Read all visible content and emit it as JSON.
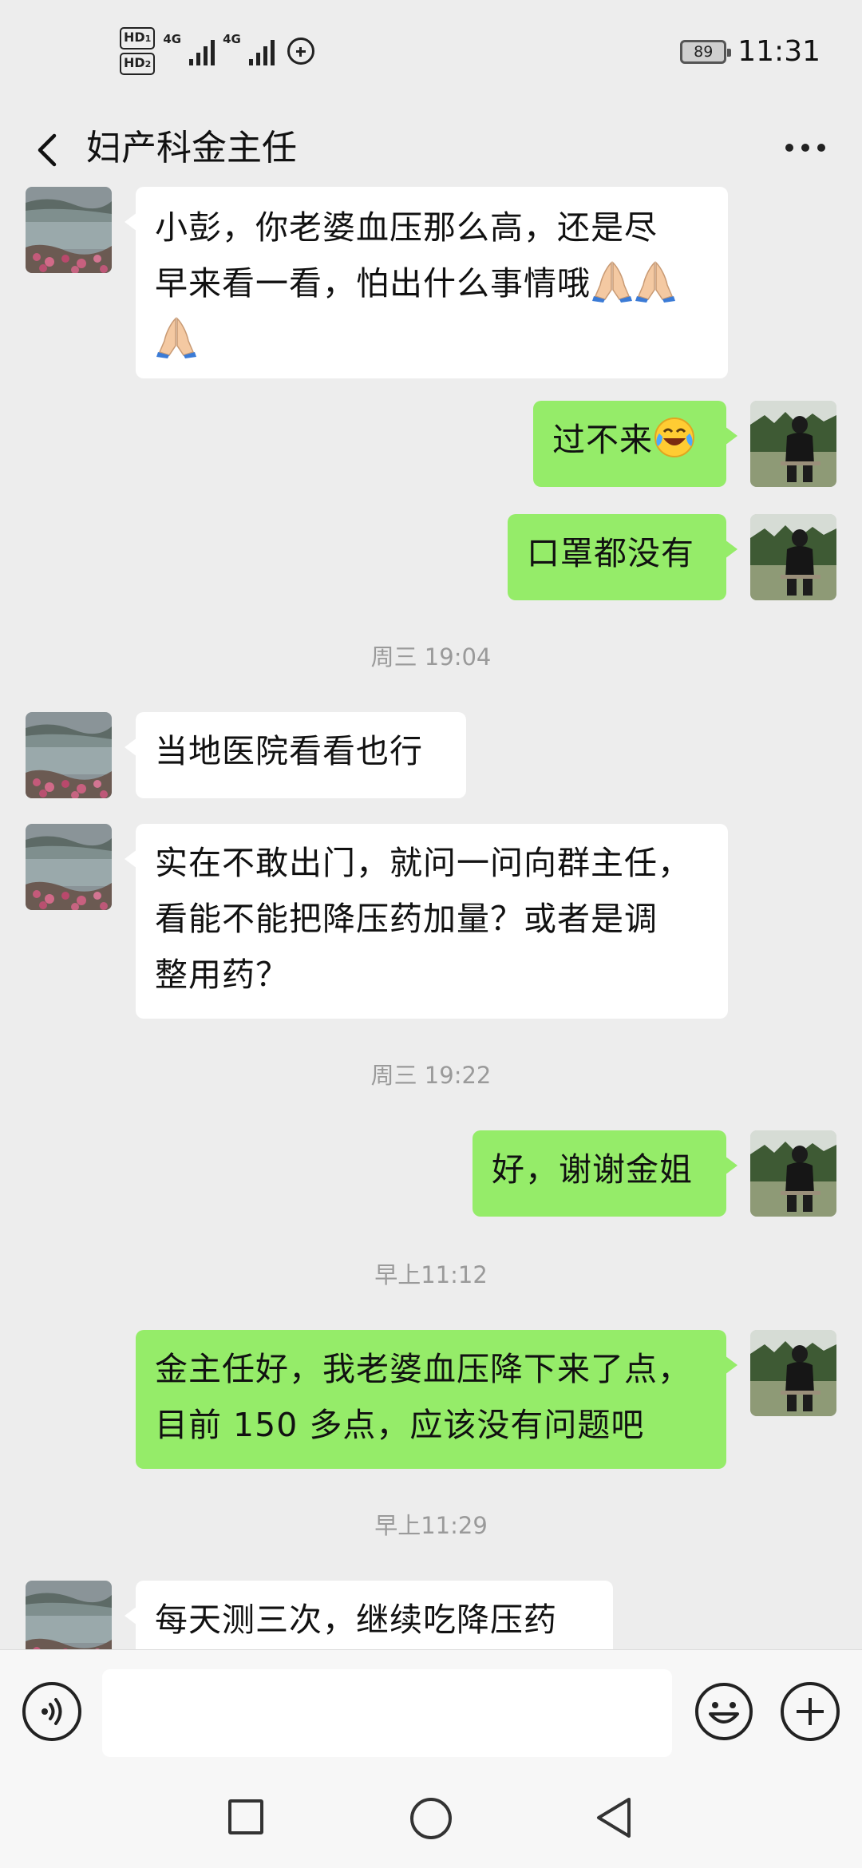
{
  "status_bar": {
    "hd1": "HD",
    "hd1_sub": "1",
    "hd2": "HD",
    "hd2_sub": "2",
    "net1": "4G",
    "net2": "4G",
    "battery": "89",
    "time": "11:31"
  },
  "header": {
    "title": "妇产科金主任",
    "back_icon": "chevron-left-icon",
    "more_icon": "more-dots-icon"
  },
  "messages": [
    {
      "side": "in",
      "text": "小彭，你老婆血压那么高，还是尽早来看一看，怕出什么事情哦",
      "emojis": [
        "pray",
        "pray",
        "pray"
      ]
    },
    {
      "side": "out",
      "text": "过不来",
      "emojis": [
        "face-with-tears"
      ]
    },
    {
      "side": "out",
      "text": "口罩都没有"
    },
    {
      "type": "time",
      "text": "周三 19:04"
    },
    {
      "side": "in",
      "text": "当地医院看看也行"
    },
    {
      "side": "in",
      "text": "实在不敢出门，就问一问向群主任，看能不能把降压药加量？或者是调整用药？"
    },
    {
      "type": "time",
      "text": "周三 19:22"
    },
    {
      "side": "out",
      "text": "好，谢谢金姐"
    },
    {
      "type": "time",
      "text": "早上11:12"
    },
    {
      "side": "out",
      "text": "金主任好，我老婆血压降下来了点，目前 150 多点，应该没有问题吧"
    },
    {
      "type": "time",
      "text": "早上11:29"
    },
    {
      "side": "in",
      "text": "每天测三次，继续吃降压药"
    }
  ],
  "m": {
    "m1a": "小彭，你老婆血压那么高，还是尽",
    "m1b": "早来看一看，怕出什么事情哦",
    "m2": "过不来",
    "m3": "口罩都没有",
    "t1": "周三 19:04",
    "m4": "当地医院看看也行",
    "m5a": "实在不敢出门，就问一问向群主任，",
    "m5b": "看能不能把降压药加量？或者是调",
    "m5c": "整用药？",
    "t2": "周三 19:22",
    "m6": "好，谢谢金姐",
    "t3": "早上11:12",
    "m7a": "金主任好，我老婆血压降下来了点，",
    "m7b": "目前 150 多点，应该没有问题吧",
    "t4": "早上11:29",
    "m8": "每天测三次，继续吃降压药"
  },
  "input_bar": {
    "voice_icon": "voice-icon",
    "emoji_icon": "emoji-smile-icon",
    "plus_icon": "plus-circle-icon",
    "text_value": ""
  },
  "nav_bar": {
    "recent_icon": "square-recents-icon",
    "home_icon": "circle-home-icon",
    "back_icon": "triangle-back-icon"
  },
  "colors": {
    "background": "#ededed",
    "bubble_out": "#95ec69",
    "bubble_in": "#ffffff",
    "timestamp": "#9a9a9a"
  }
}
